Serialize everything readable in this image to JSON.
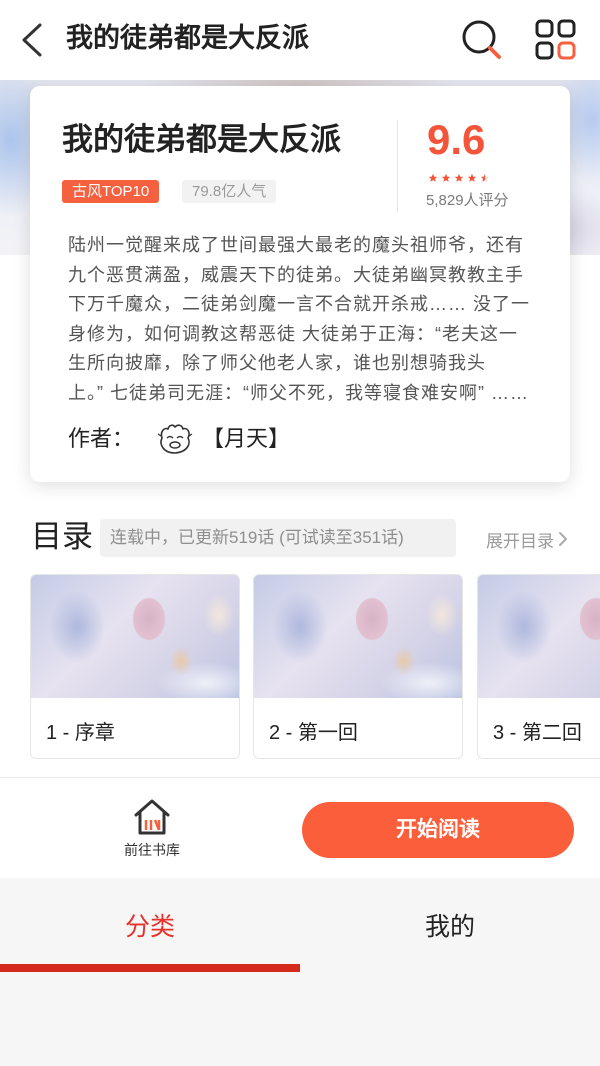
{
  "header": {
    "title": "我的徒弟都是大反派",
    "icons": {
      "back": "chevron-left-icon",
      "search": "search-icon",
      "menu": "grid-icon"
    }
  },
  "book": {
    "title": "我的徒弟都是大反派",
    "tag": "古风TOP10",
    "popularity": "79.8亿人气",
    "score": "9.6",
    "stars": 4.5,
    "rating_count": "5,829人评分",
    "description_lines": [
      "陆州一觉醒来成了世间最强大最老的魔头祖师爷，还有",
      "九个恶贯满盈，威震天下的徒弟。大徒弟幽冥教教主手",
      "下万千魔众，二徒弟剑魔一言不合就开杀戒…… 没了一",
      "身修为，如何调教这帮恶徒 大徒弟于正海：“老夫这一",
      "生所向披靡，除了师父他老人家，谁也别想骑我头",
      "上。” 七徒弟司无涯：“师父不死，我等寝食难安啊” ……"
    ],
    "author_label": "作者：",
    "author_name": "【月天】"
  },
  "catalog": {
    "title": "目录",
    "status": "连载中，已更新519话 (可试读至351话)",
    "expand_label": "展开目录"
  },
  "chapters": [
    {
      "label": "1 - 序章"
    },
    {
      "label": "2 - 第一回"
    },
    {
      "label": "3 - 第二回"
    }
  ],
  "actions": {
    "library_label": "前往书库",
    "library_icon": "house-icon",
    "read_label": "开始阅读"
  },
  "tabs": [
    {
      "label": "分类",
      "active": true
    },
    {
      "label": "我的",
      "active": false
    }
  ],
  "colors": {
    "accent": "#f5603f",
    "score": "#f4553a",
    "read_button": "#fb5e3b",
    "tab_active": "#e5322b",
    "tab_underline": "#d42a1e"
  }
}
